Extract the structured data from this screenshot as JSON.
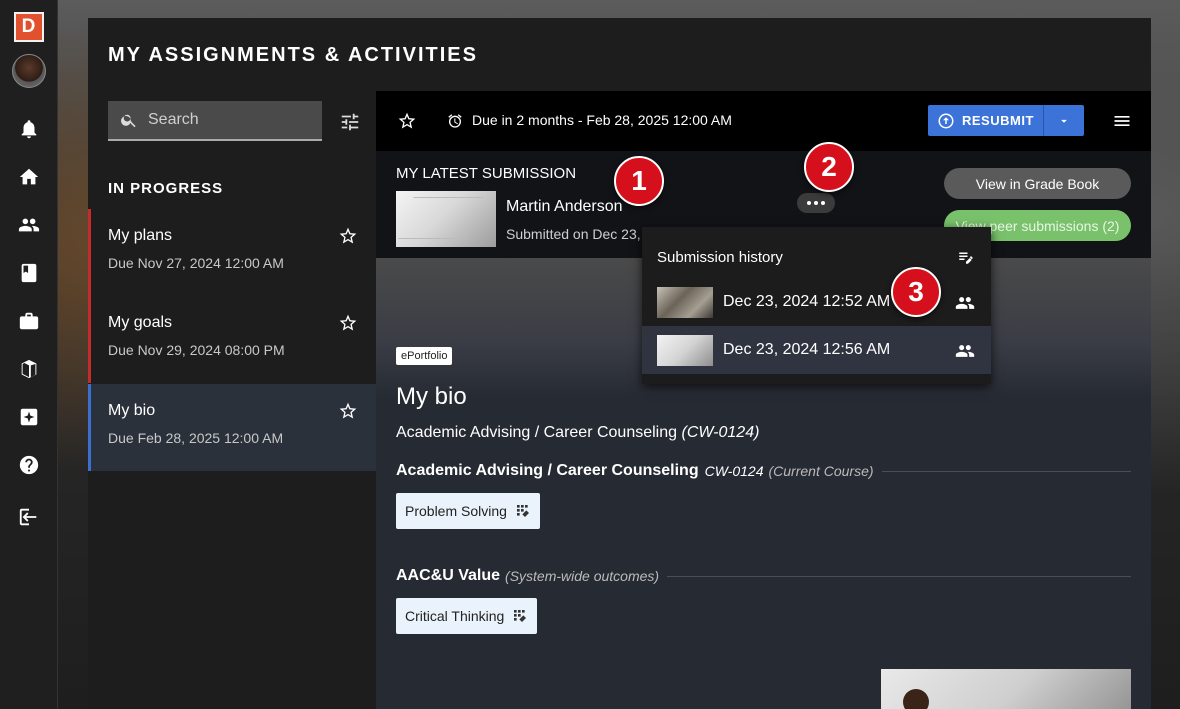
{
  "app": {
    "logo_letter": "D"
  },
  "rail": {
    "items": [
      "bell-icon",
      "home-icon",
      "people-icon",
      "book-icon",
      "briefcase-icon",
      "portfolio-icon",
      "sparkle-icon",
      "help-icon",
      "logout-icon"
    ]
  },
  "page": {
    "title": "MY ASSIGNMENTS & ACTIVITIES"
  },
  "sidebar": {
    "search_placeholder": "Search",
    "section_label": "IN PROGRESS",
    "items": [
      {
        "title": "My plans",
        "due": "Due Nov 27, 2024 12:00 AM",
        "accent": "#c62b2b"
      },
      {
        "title": "My goals",
        "due": "Due Nov 29, 2024 08:00 PM",
        "accent": "#c62b2b"
      },
      {
        "title": "My bio",
        "due": "Due Feb 28, 2025 12:00 AM",
        "accent": "#3a6fd0",
        "active": true
      }
    ]
  },
  "toolbar": {
    "due_text": "Due in 2 months - Feb 28, 2025 12:00 AM",
    "resubmit_label": "RESUBMIT",
    "accent": "#3b73d9"
  },
  "submission": {
    "section_label": "MY LATEST SUBMISSION",
    "author": "Martin Anderson",
    "submitted_text": "Submitted on Dec 23,",
    "grade_button": "View in Grade Book",
    "peer_button": "View peer submissions (2)"
  },
  "history": {
    "title": "Submission history",
    "rows": [
      {
        "date": "Dec 23, 2024 12:52 AM"
      },
      {
        "date": "Dec 23, 2024 12:56 AM",
        "selected": true
      }
    ]
  },
  "bio": {
    "tag": "ePortfolio",
    "title": "My bio",
    "course_name": "Academic Advising / Career Counseling",
    "course_code": "(CW-0124)"
  },
  "outcomes": [
    {
      "name": "Academic Advising / Career Counseling",
      "code": "CW-0124",
      "note": "(Current Course)",
      "chip": "Problem Solving"
    },
    {
      "name": "AAC&U Value",
      "code": "",
      "note": "(System-wide outcomes)",
      "chip": "Critical Thinking"
    }
  ],
  "callouts": [
    "1",
    "2",
    "3"
  ]
}
